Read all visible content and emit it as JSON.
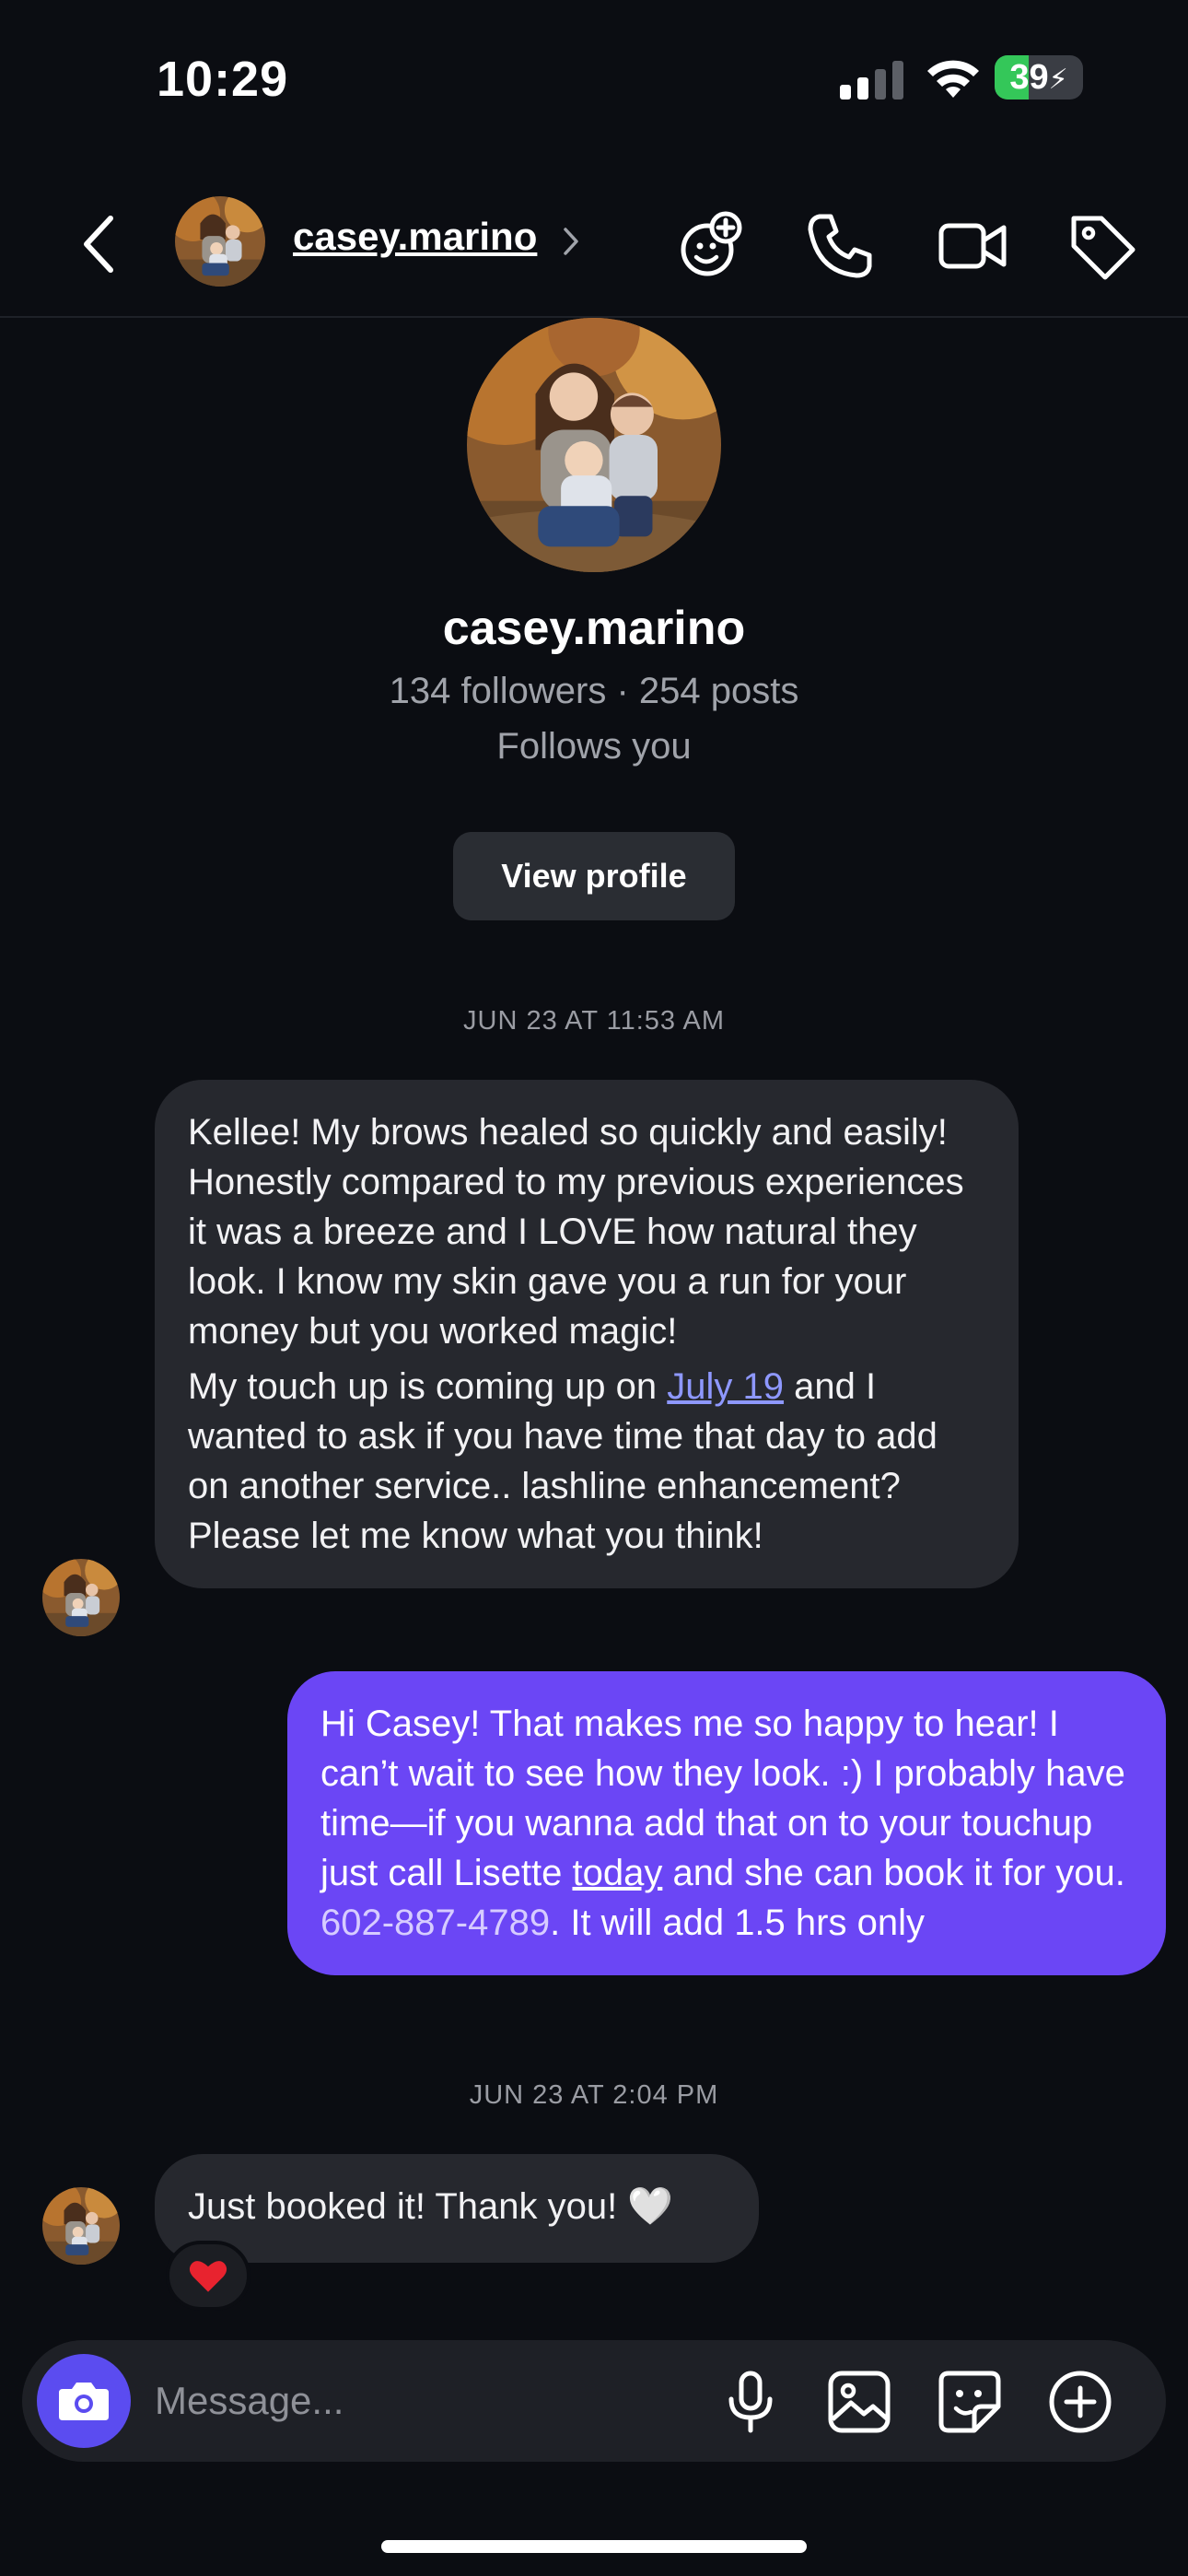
{
  "status_bar": {
    "time": "10:29",
    "battery_level": "39",
    "battery_percent": 39
  },
  "header": {
    "username": "casey.marino"
  },
  "profile": {
    "name": "casey.marino",
    "stats": "134 followers · 254 posts",
    "follows_you": "Follows you",
    "view_profile_label": "View profile"
  },
  "conversation": {
    "timestamp_1": "JUN 23 AT 11:53 AM",
    "msg1": {
      "part1": "Kellee! My brows healed so quickly and easily! Honestly compared to my previous experiences it was a breeze and I LOVE how natural they look. I know my skin gave you a run for your money but you worked magic!",
      "part2_before": "My touch up is coming up on ",
      "part2_link": "July 19",
      "part2_after": " and I wanted to ask if you have time that day to add on another service.. lashline enhancement? Please let me know what you think!"
    },
    "msg2": {
      "before": "Hi Casey! That makes me so happy to hear! I can’t wait to see how they look. :) I probably have time—if you wanna add that on to your touchup just call Lisette ",
      "link": "today",
      "middle": " and she can book it for you. ",
      "phone": "602-887-4789",
      "after": ". It will add 1.5 hrs only"
    },
    "timestamp_2": "JUN 23 AT 2:04 PM",
    "msg3": "Just booked it! Thank you! 🤍",
    "reaction": "❤️"
  },
  "composer": {
    "placeholder": "Message..."
  },
  "colors": {
    "background": "#0b0d12",
    "incoming_bubble": "#26282e",
    "outgoing_bubble": "#6b46f5",
    "camera_button": "#5b4cf0",
    "battery_green": "#34c759"
  },
  "icons": {
    "back": "chevron-left-icon",
    "effects": "face-sparkle-icon",
    "call": "phone-icon",
    "video": "video-camera-icon",
    "tag": "tag-icon",
    "camera": "camera-icon",
    "mic": "microphone-icon",
    "gallery": "image-icon",
    "sticker": "sticker-icon",
    "more": "plus-circle-icon"
  }
}
